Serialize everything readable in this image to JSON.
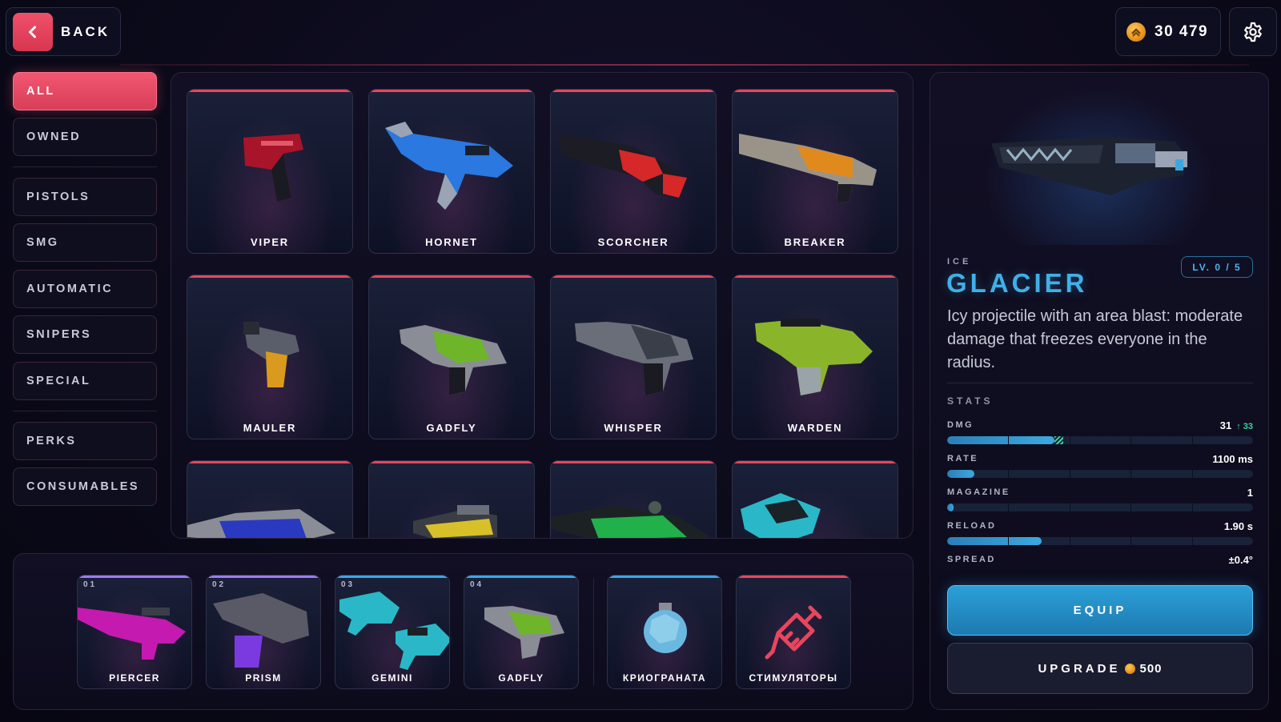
{
  "topbar": {
    "back_label": "BACK",
    "coins": "30 479",
    "coin_color": "#f5a623"
  },
  "sidebar": {
    "items": [
      {
        "label": "ALL",
        "active": true
      },
      {
        "label": "OWNED"
      },
      {
        "label": "PISTOLS"
      },
      {
        "label": "SMG"
      },
      {
        "label": "AUTOMATIC"
      },
      {
        "label": "SNIPERS"
      },
      {
        "label": "SPECIAL"
      },
      {
        "label": "PERKS"
      },
      {
        "label": "CONSUMABLES"
      }
    ]
  },
  "grid": {
    "weapons": [
      {
        "name": "VIPER",
        "color": "#b3182e"
      },
      {
        "name": "HORNET",
        "color": "#2a78e0"
      },
      {
        "name": "SCORCHER",
        "color": "#d62828"
      },
      {
        "name": "BREAKER",
        "color": "#e08a1e"
      },
      {
        "name": "MAULER",
        "color": "#d99a1e"
      },
      {
        "name": "GADFLY",
        "color": "#6fb52a"
      },
      {
        "name": "WHISPER",
        "color": "#5a6070"
      },
      {
        "name": "WARDEN",
        "color": "#8ab52a"
      },
      {
        "name": "",
        "color": "#2a3ac0"
      },
      {
        "name": "",
        "color": "#d8c02a"
      },
      {
        "name": "",
        "color": "#22b04a"
      },
      {
        "name": "",
        "color": "#2ab8c8"
      }
    ]
  },
  "loadout": {
    "slots": [
      {
        "num": "01",
        "name": "PIERCER",
        "color": "#c41ab0",
        "top": "#9b7cf0"
      },
      {
        "num": "02",
        "name": "PRISM",
        "color": "#7a3ae0",
        "top": "#9b7cf0"
      },
      {
        "num": "03",
        "name": "GEMINI",
        "color": "#2ab8c8",
        "top": "#3aa8e8"
      },
      {
        "num": "04",
        "name": "GADFLY",
        "color": "#6fb52a",
        "top": "#3aa8e8"
      },
      {
        "num": "",
        "name": "КРИОГРАНАТА",
        "color": "#6ab8e0",
        "top": "#3aa8e8"
      },
      {
        "num": "",
        "name": "СТИМУЛЯТОРЫ",
        "color": "#e8465e",
        "top": "#e8465e"
      }
    ]
  },
  "detail": {
    "element": "ICE",
    "level": "LV. 0 / 5",
    "name": "GLACIER",
    "description": "Icy projectile with an area blast: moderate damage that freezes everyone in the radius.",
    "stats_title": "STATS",
    "stats": [
      {
        "label": "DMG",
        "value": "31",
        "upgrade": "33",
        "fill": 0.35,
        "bonus": 0.03
      },
      {
        "label": "RATE",
        "value": "1100 ms",
        "fill": 0.09
      },
      {
        "label": "MAGAZINE",
        "value": "1",
        "fill": 0.02
      },
      {
        "label": "RELOAD",
        "value": "1.90 s",
        "fill": 0.31
      },
      {
        "label": "SPREAD",
        "value": "±0.4°"
      }
    ],
    "equip_label": "EQUIP",
    "upgrade_label": "UPGRADE",
    "upgrade_cost": "500",
    "accent": "#3fb0e8"
  }
}
